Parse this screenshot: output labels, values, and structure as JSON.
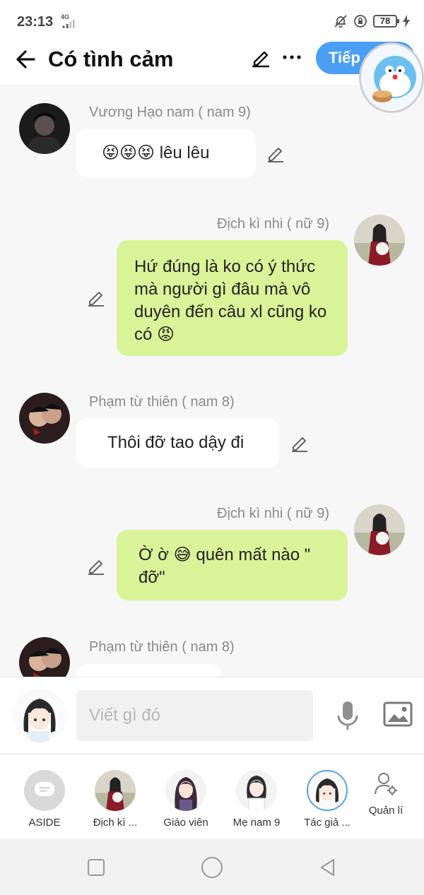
{
  "status": {
    "time": "23:13",
    "network": "4G",
    "battery": "78"
  },
  "header": {
    "title": "Có tình cảm",
    "next_label": "Tiếp"
  },
  "messages": [
    {
      "name": "Vương Hạo nam ( nam 9)",
      "text": "😝😝😝 lêu lêu"
    },
    {
      "name": "Địch kì nhi ( nữ 9)",
      "text": "Hứ đúng là ko có ý thức mà người gì đâu mà vô duyên đến câu xl cũng ko có 😡"
    },
    {
      "name": "Phạm từ thiên ( nam 8)",
      "text": "Thôi đỡ tao dậy đi"
    },
    {
      "name": "Địch kì nhi ( nữ 9)",
      "text": "Ờ ờ 😅 quên mất nào \" đỡ\""
    },
    {
      "name": "Phạm từ thiên ( nam 8)",
      "text": ""
    }
  ],
  "input": {
    "placeholder": "Viết gì đó"
  },
  "characters": [
    {
      "label": "ASIDE"
    },
    {
      "label": "Địch kì ..."
    },
    {
      "label": "Giáo viên"
    },
    {
      "label": "Mẹ nam 9"
    },
    {
      "label": "Tác giả ..."
    }
  ],
  "manage_label": "Quản lí",
  "colors": {
    "accent": "#4a9ff5",
    "bubble_right": "#d9f398",
    "bubble_left": "#ffffff"
  }
}
